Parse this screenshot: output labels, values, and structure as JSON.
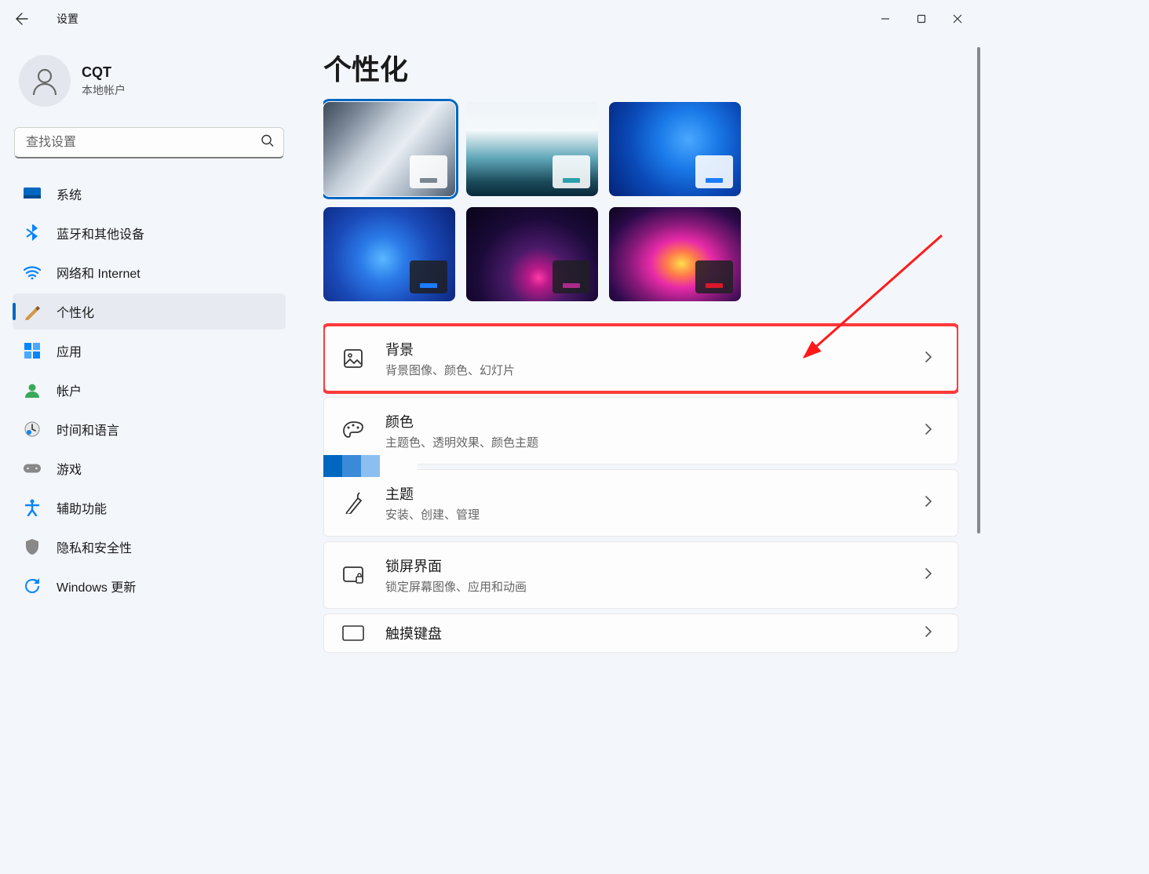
{
  "titlebar": {
    "title": "设置"
  },
  "profile": {
    "name": "CQT",
    "subtitle": "本地帐户"
  },
  "search": {
    "placeholder": "查找设置"
  },
  "nav": [
    {
      "id": "system",
      "label": "系统"
    },
    {
      "id": "bluetooth",
      "label": "蓝牙和其他设备"
    },
    {
      "id": "network",
      "label": "网络和 Internet"
    },
    {
      "id": "personalize",
      "label": "个性化",
      "selected": true
    },
    {
      "id": "apps",
      "label": "应用"
    },
    {
      "id": "accounts",
      "label": "帐户"
    },
    {
      "id": "time",
      "label": "时间和语言"
    },
    {
      "id": "gaming",
      "label": "游戏"
    },
    {
      "id": "accessibility",
      "label": "辅助功能"
    },
    {
      "id": "privacy",
      "label": "隐私和安全性"
    },
    {
      "id": "update",
      "label": "Windows 更新"
    }
  ],
  "page": {
    "title": "个性化"
  },
  "themes": [
    {
      "bar": "#7a8690",
      "selected": true,
      "miniDark": false
    },
    {
      "bar": "#2aa0aa",
      "miniDark": false
    },
    {
      "bar": "#1a7cff",
      "miniDark": false
    },
    {
      "bar": "#1a7cff",
      "miniDark": true
    },
    {
      "bar": "#aa2a8a",
      "miniDark": true
    },
    {
      "bar": "#d8182a",
      "miniDark": true
    }
  ],
  "items": [
    {
      "id": "background",
      "title": "背景",
      "sub": "背景图像、颜色、幻灯片",
      "highlighted": true
    },
    {
      "id": "colors",
      "title": "颜色",
      "sub": "主题色、透明效果、颜色主题"
    },
    {
      "id": "themes",
      "title": "主题",
      "sub": "安装、创建、管理"
    },
    {
      "id": "lockscreen",
      "title": "锁屏界面",
      "sub": "锁定屏幕图像、应用和动画"
    },
    {
      "id": "touchkbd",
      "title": "触摸键盘",
      "sub": ""
    }
  ]
}
